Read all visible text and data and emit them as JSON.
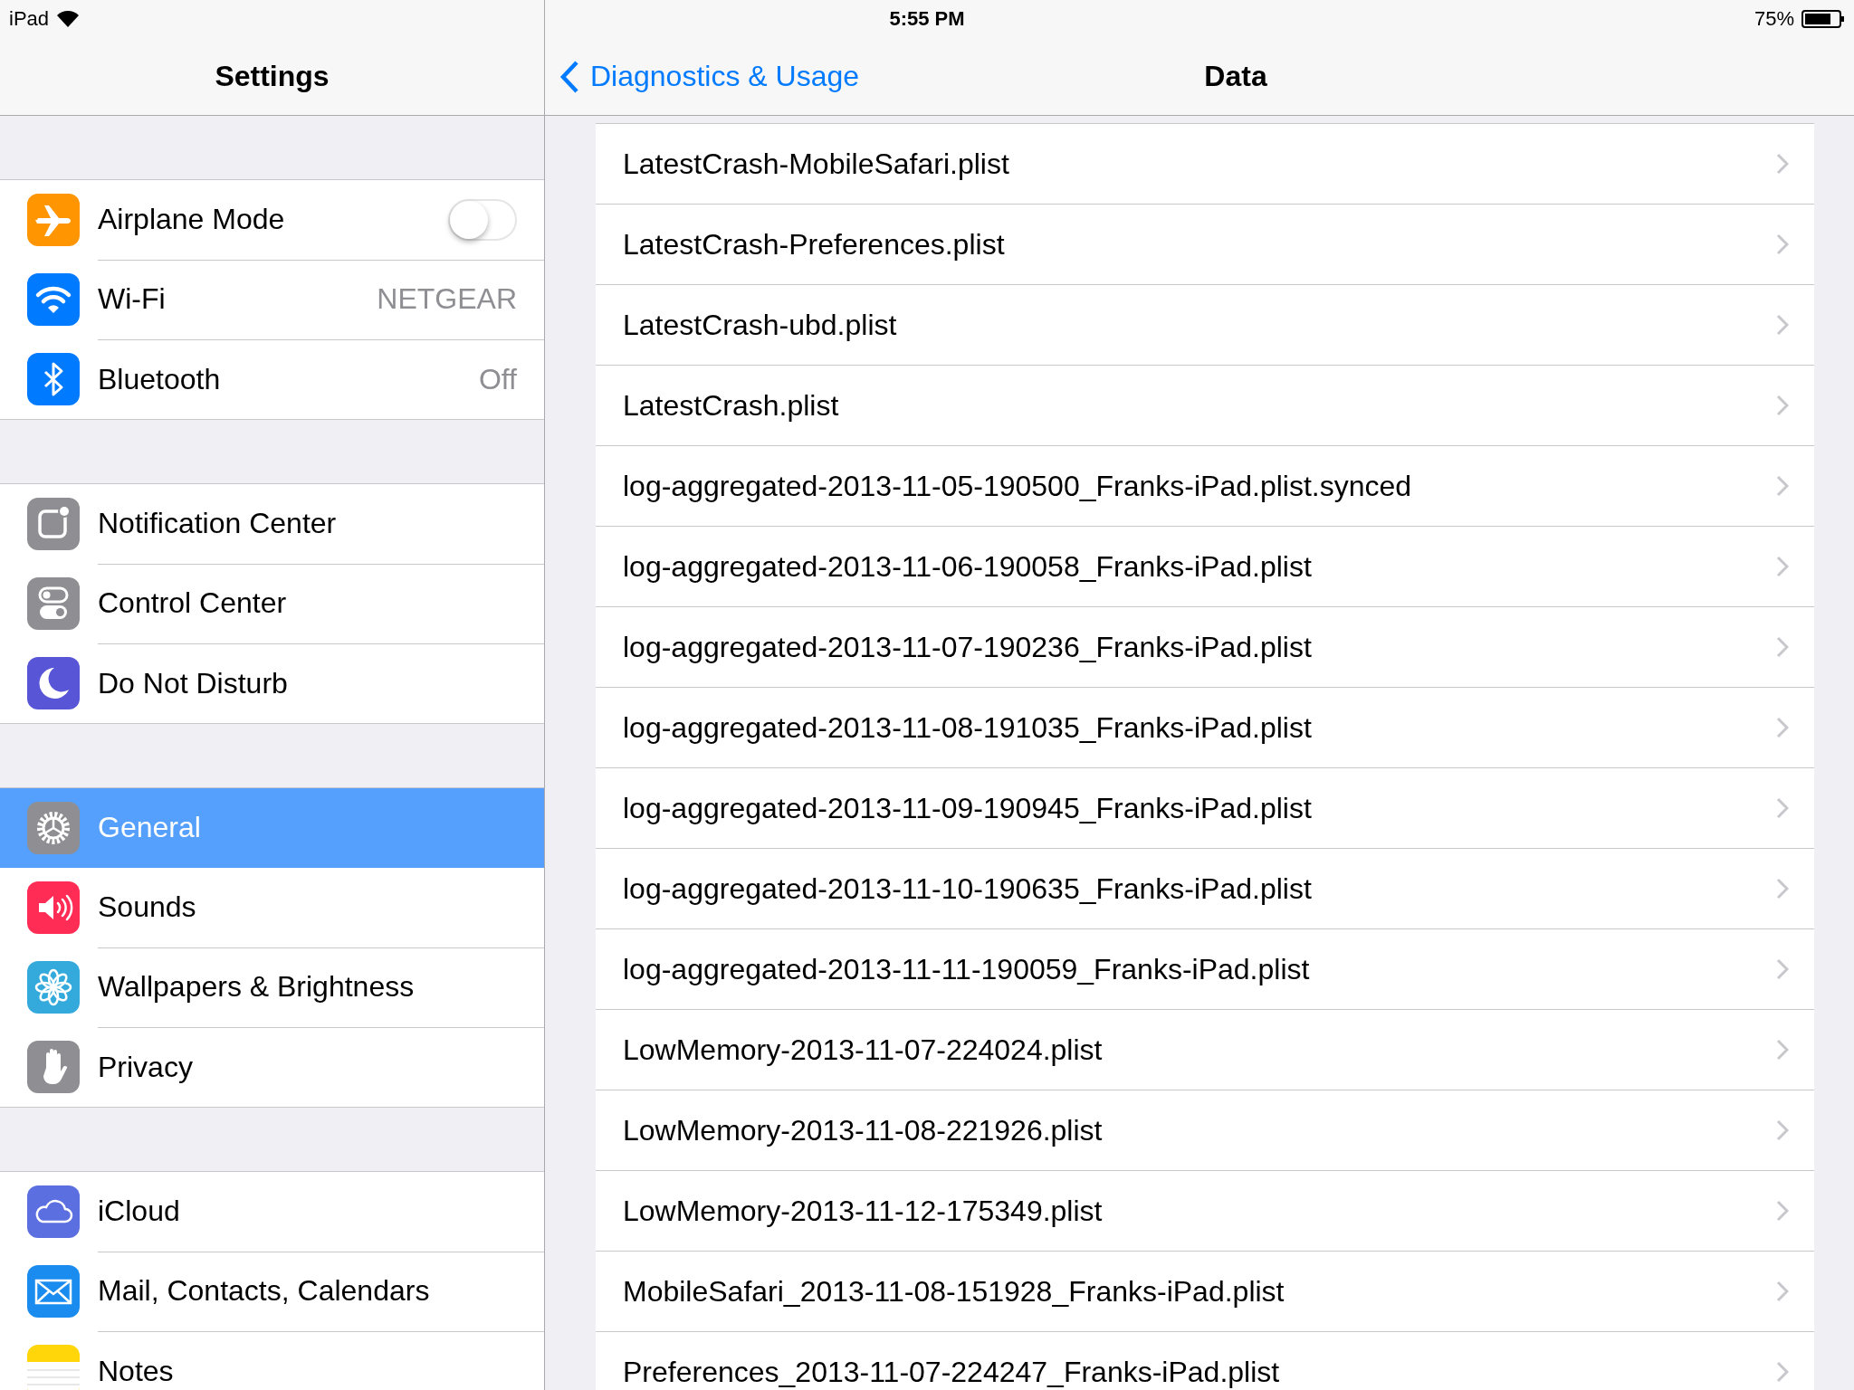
{
  "status_bar": {
    "device": "iPad",
    "time": "5:55 PM",
    "battery": "75%"
  },
  "sidebar": {
    "title": "Settings",
    "groups": [
      {
        "items": [
          {
            "label": "Airplane Mode",
            "kind": "toggle",
            "on": false,
            "selected": false,
            "color": "#ff9500"
          },
          {
            "label": "Wi-Fi",
            "kind": "value",
            "value": "NETGEAR",
            "selected": false,
            "color": "#007aff"
          },
          {
            "label": "Bluetooth",
            "kind": "value",
            "value": "Off",
            "selected": false,
            "color": "#007aff"
          }
        ]
      },
      {
        "items": [
          {
            "label": "Notification Center",
            "kind": "plain",
            "selected": false,
            "color": "#8e8e93"
          },
          {
            "label": "Control Center",
            "kind": "plain",
            "selected": false,
            "color": "#8e8e93"
          },
          {
            "label": "Do Not Disturb",
            "kind": "plain",
            "selected": false,
            "color": "#5856d6"
          }
        ]
      },
      {
        "items": [
          {
            "label": "General",
            "kind": "plain",
            "selected": true,
            "color": "#8e8e93"
          },
          {
            "label": "Sounds",
            "kind": "plain",
            "selected": false,
            "color": "#ff2d55"
          },
          {
            "label": "Wallpapers & Brightness",
            "kind": "plain",
            "selected": false,
            "color": "#34aadc"
          },
          {
            "label": "Privacy",
            "kind": "plain",
            "selected": false,
            "color": "#8e8e93"
          }
        ]
      },
      {
        "items": [
          {
            "label": "iCloud",
            "kind": "plain",
            "selected": false,
            "color": "#5b6fe0"
          },
          {
            "label": "Mail, Contacts, Calendars",
            "kind": "plain",
            "selected": false,
            "color": "#1a8cf0"
          },
          {
            "label": "Notes",
            "kind": "plain",
            "selected": false,
            "color": "#ffd60a"
          }
        ]
      }
    ]
  },
  "detail": {
    "back": "Diagnostics & Usage",
    "title": "Data",
    "rows": [
      "LatestCrash-MobileSafari.plist",
      "LatestCrash-Preferences.plist",
      "LatestCrash-ubd.plist",
      "LatestCrash.plist",
      "log-aggregated-2013-11-05-190500_Franks-iPad.plist.synced",
      "log-aggregated-2013-11-06-190058_Franks-iPad.plist",
      "log-aggregated-2013-11-07-190236_Franks-iPad.plist",
      "log-aggregated-2013-11-08-191035_Franks-iPad.plist",
      "log-aggregated-2013-11-09-190945_Franks-iPad.plist",
      "log-aggregated-2013-11-10-190635_Franks-iPad.plist",
      "log-aggregated-2013-11-11-190059_Franks-iPad.plist",
      "LowMemory-2013-11-07-224024.plist",
      "LowMemory-2013-11-08-221926.plist",
      "LowMemory-2013-11-12-175349.plist",
      "MobileSafari_2013-11-08-151928_Franks-iPad.plist",
      "Preferences_2013-11-07-224247_Franks-iPad.plist"
    ]
  }
}
